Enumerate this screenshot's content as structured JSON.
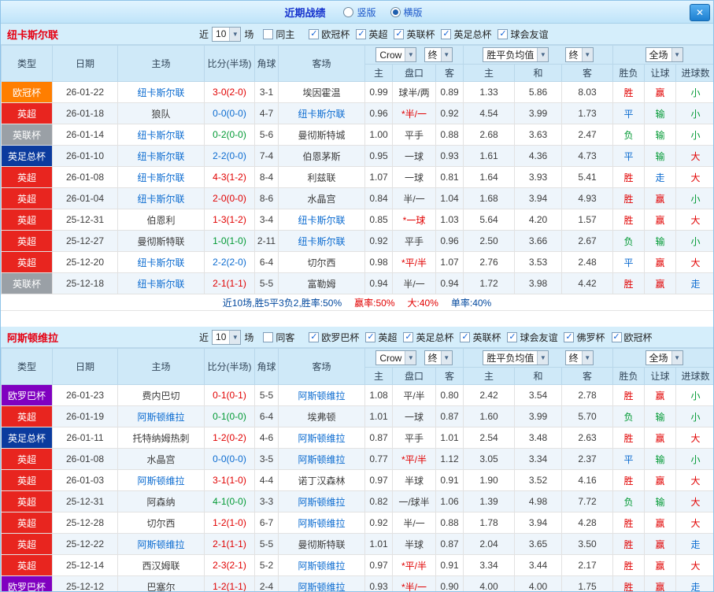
{
  "palette": {
    "red": "#e10000",
    "green": "#009933",
    "blue": "#0b6bd0",
    "dark": "#3c3c3c",
    "focal": "#0b6bd0",
    "navy_text": "#00479d",
    "league": {
      "欧冠杯": "#ff7e00",
      "英超": "#e8251f",
      "英联杯": "#9aa0a6",
      "英足总杯": "#0b3b9e",
      "欧罗巴杯": "#8000c0"
    }
  },
  "titlebar": {
    "title": "近期战绩",
    "vertical_label": "竖版",
    "horizontal_label": "横版",
    "close_glyph": "✕"
  },
  "controls": {
    "near_label": "近",
    "games_label": "场",
    "bookmaker": "Crow",
    "stage_final": "终",
    "avg_label": "胜平负均值",
    "scope": "全场",
    "check_glyph": "✓"
  },
  "table": {
    "cols": [
      "类型",
      "日期",
      "主场",
      "比分(半场)",
      "角球",
      "客场"
    ],
    "subcols": [
      "主",
      "盘口",
      "客",
      "主",
      "和",
      "客",
      "胜负",
      "让球",
      "进球数"
    ]
  },
  "sections": [
    {
      "team": "纽卡斯尔联",
      "count": "10",
      "same_label": "同主",
      "leagues": [
        "欧冠杯",
        "英超",
        "英联杯",
        "英足总杯",
        "球会友谊"
      ],
      "rows": [
        {
          "league": "欧冠杯",
          "date": "26-01-22",
          "home": "纽卡斯尔联",
          "home_c": "focal",
          "score": "3-0(2-0)",
          "score_c": "red",
          "corner": "3-1",
          "away": "埃因霍温",
          "away_c": "dark",
          "odds": [
            "0.99",
            "球半/两",
            "0.89"
          ],
          "pan_c": "dark",
          "avg": [
            "1.33",
            "5.86",
            "8.03"
          ],
          "res": [
            "胜",
            "red"
          ],
          "cover": [
            "赢",
            "red"
          ],
          "goals": [
            "小",
            "green"
          ]
        },
        {
          "league": "英超",
          "date": "26-01-18",
          "home": "狼队",
          "home_c": "dark",
          "score": "0-0(0-0)",
          "score_c": "blue",
          "corner": "4-7",
          "away": "纽卡斯尔联",
          "away_c": "focal",
          "odds": [
            "0.96",
            "*半/一",
            "0.92"
          ],
          "pan_c": "red",
          "avg": [
            "4.54",
            "3.99",
            "1.73"
          ],
          "res": [
            "平",
            "blue"
          ],
          "cover": [
            "输",
            "green"
          ],
          "goals": [
            "小",
            "green"
          ]
        },
        {
          "league": "英联杯",
          "date": "26-01-14",
          "home": "纽卡斯尔联",
          "home_c": "focal",
          "score": "0-2(0-0)",
          "score_c": "green",
          "corner": "5-6",
          "away": "曼彻斯特城",
          "away_c": "dark",
          "odds": [
            "1.00",
            "平手",
            "0.88"
          ],
          "pan_c": "dark",
          "avg": [
            "2.68",
            "3.63",
            "2.47"
          ],
          "res": [
            "负",
            "green"
          ],
          "cover": [
            "输",
            "green"
          ],
          "goals": [
            "小",
            "green"
          ]
        },
        {
          "league": "英足总杯",
          "date": "26-01-10",
          "home": "纽卡斯尔联",
          "home_c": "focal",
          "score": "2-2(0-0)",
          "score_c": "blue",
          "corner": "7-4",
          "away": "伯恩茅斯",
          "away_c": "dark",
          "odds": [
            "0.95",
            "一球",
            "0.93"
          ],
          "pan_c": "dark",
          "avg": [
            "1.61",
            "4.36",
            "4.73"
          ],
          "res": [
            "平",
            "blue"
          ],
          "cover": [
            "输",
            "green"
          ],
          "goals": [
            "大",
            "red"
          ]
        },
        {
          "league": "英超",
          "date": "26-01-08",
          "home": "纽卡斯尔联",
          "home_c": "focal",
          "score": "4-3(1-2)",
          "score_c": "red",
          "corner": "8-4",
          "away": "利兹联",
          "away_c": "dark",
          "odds": [
            "1.07",
            "一球",
            "0.81"
          ],
          "pan_c": "dark",
          "avg": [
            "1.64",
            "3.93",
            "5.41"
          ],
          "res": [
            "胜",
            "red"
          ],
          "cover": [
            "走",
            "blue"
          ],
          "goals": [
            "大",
            "red"
          ]
        },
        {
          "league": "英超",
          "date": "26-01-04",
          "home": "纽卡斯尔联",
          "home_c": "focal",
          "score": "2-0(0-0)",
          "score_c": "red",
          "corner": "8-6",
          "away": "水晶宫",
          "away_c": "dark",
          "odds": [
            "0.84",
            "半/一",
            "1.04"
          ],
          "pan_c": "dark",
          "avg": [
            "1.68",
            "3.94",
            "4.93"
          ],
          "res": [
            "胜",
            "red"
          ],
          "cover": [
            "赢",
            "red"
          ],
          "goals": [
            "小",
            "green"
          ]
        },
        {
          "league": "英超",
          "date": "25-12-31",
          "home": "伯恩利",
          "home_c": "dark",
          "score": "1-3(1-2)",
          "score_c": "red",
          "corner": "3-4",
          "away": "纽卡斯尔联",
          "away_c": "focal",
          "odds": [
            "0.85",
            "*一球",
            "1.03"
          ],
          "pan_c": "red",
          "avg": [
            "5.64",
            "4.20",
            "1.57"
          ],
          "res": [
            "胜",
            "red"
          ],
          "cover": [
            "赢",
            "red"
          ],
          "goals": [
            "大",
            "red"
          ]
        },
        {
          "league": "英超",
          "date": "25-12-27",
          "home": "曼彻斯特联",
          "home_c": "dark",
          "score": "1-0(1-0)",
          "score_c": "green",
          "corner": "2-11",
          "away": "纽卡斯尔联",
          "away_c": "focal",
          "odds": [
            "0.92",
            "平手",
            "0.96"
          ],
          "pan_c": "dark",
          "avg": [
            "2.50",
            "3.66",
            "2.67"
          ],
          "res": [
            "负",
            "green"
          ],
          "cover": [
            "输",
            "green"
          ],
          "goals": [
            "小",
            "green"
          ]
        },
        {
          "league": "英超",
          "date": "25-12-20",
          "home": "纽卡斯尔联",
          "home_c": "focal",
          "score": "2-2(2-0)",
          "score_c": "blue",
          "corner": "6-4",
          "away": "切尔西",
          "away_c": "dark",
          "odds": [
            "0.98",
            "*平/半",
            "1.07"
          ],
          "pan_c": "red",
          "avg": [
            "2.76",
            "3.53",
            "2.48"
          ],
          "res": [
            "平",
            "blue"
          ],
          "cover": [
            "赢",
            "red"
          ],
          "goals": [
            "大",
            "red"
          ]
        },
        {
          "league": "英联杯",
          "date": "25-12-18",
          "home": "纽卡斯尔联",
          "home_c": "focal",
          "score": "2-1(1-1)",
          "score_c": "red",
          "corner": "5-5",
          "away": "富勒姆",
          "away_c": "dark",
          "odds": [
            "0.94",
            "半/一",
            "0.94"
          ],
          "pan_c": "dark",
          "avg": [
            "1.72",
            "3.98",
            "4.42"
          ],
          "res": [
            "胜",
            "red"
          ],
          "cover": [
            "赢",
            "red"
          ],
          "goals": [
            "走",
            "blue"
          ]
        }
      ],
      "summary": [
        [
          "近10场,胜5平3负2,胜率:50%",
          "navy_text"
        ],
        [
          "赢率:50%",
          "red"
        ],
        [
          "大:40%",
          "red"
        ],
        [
          "单率:40%",
          "navy_text"
        ]
      ]
    },
    {
      "team": "阿斯顿维拉",
      "count": "10",
      "same_label": "同客",
      "leagues": [
        "欧罗巴杯",
        "英超",
        "英足总杯",
        "英联杯",
        "球会友谊",
        "佛罗杯",
        "欧冠杯"
      ],
      "rows": [
        {
          "league": "欧罗巴杯",
          "date": "26-01-23",
          "home": "费内巴切",
          "home_c": "dark",
          "score": "0-1(0-1)",
          "score_c": "red",
          "corner": "5-5",
          "away": "阿斯顿维拉",
          "away_c": "focal",
          "odds": [
            "1.08",
            "平/半",
            "0.80"
          ],
          "pan_c": "dark",
          "avg": [
            "2.42",
            "3.54",
            "2.78"
          ],
          "res": [
            "胜",
            "red"
          ],
          "cover": [
            "赢",
            "red"
          ],
          "goals": [
            "小",
            "green"
          ]
        },
        {
          "league": "英超",
          "date": "26-01-19",
          "home": "阿斯顿维拉",
          "home_c": "focal",
          "score": "0-1(0-0)",
          "score_c": "green",
          "corner": "6-4",
          "away": "埃弗顿",
          "away_c": "dark",
          "odds": [
            "1.01",
            "一球",
            "0.87"
          ],
          "pan_c": "dark",
          "avg": [
            "1.60",
            "3.99",
            "5.70"
          ],
          "res": [
            "负",
            "green"
          ],
          "cover": [
            "输",
            "green"
          ],
          "goals": [
            "小",
            "green"
          ]
        },
        {
          "league": "英足总杯",
          "date": "26-01-11",
          "home": "托特纳姆热刺",
          "home_c": "dark",
          "score": "1-2(0-2)",
          "score_c": "red",
          "corner": "4-6",
          "away": "阿斯顿维拉",
          "away_c": "focal",
          "odds": [
            "0.87",
            "平手",
            "1.01"
          ],
          "pan_c": "dark",
          "avg": [
            "2.54",
            "3.48",
            "2.63"
          ],
          "res": [
            "胜",
            "red"
          ],
          "cover": [
            "赢",
            "red"
          ],
          "goals": [
            "大",
            "red"
          ]
        },
        {
          "league": "英超",
          "date": "26-01-08",
          "home": "水晶宫",
          "home_c": "dark",
          "score": "0-0(0-0)",
          "score_c": "blue",
          "corner": "3-5",
          "away": "阿斯顿维拉",
          "away_c": "focal",
          "odds": [
            "0.77",
            "*平/半",
            "1.12"
          ],
          "pan_c": "red",
          "avg": [
            "3.05",
            "3.34",
            "2.37"
          ],
          "res": [
            "平",
            "blue"
          ],
          "cover": [
            "输",
            "green"
          ],
          "goals": [
            "小",
            "green"
          ]
        },
        {
          "league": "英超",
          "date": "26-01-03",
          "home": "阿斯顿维拉",
          "home_c": "focal",
          "score": "3-1(1-0)",
          "score_c": "red",
          "corner": "4-4",
          "away": "诺丁汉森林",
          "away_c": "dark",
          "odds": [
            "0.97",
            "半球",
            "0.91"
          ],
          "pan_c": "dark",
          "avg": [
            "1.90",
            "3.52",
            "4.16"
          ],
          "res": [
            "胜",
            "red"
          ],
          "cover": [
            "赢",
            "red"
          ],
          "goals": [
            "大",
            "red"
          ]
        },
        {
          "league": "英超",
          "date": "25-12-31",
          "home": "阿森纳",
          "home_c": "dark",
          "score": "4-1(0-0)",
          "score_c": "green",
          "corner": "3-3",
          "away": "阿斯顿维拉",
          "away_c": "focal",
          "odds": [
            "0.82",
            "一/球半",
            "1.06"
          ],
          "pan_c": "dark",
          "avg": [
            "1.39",
            "4.98",
            "7.72"
          ],
          "res": [
            "负",
            "green"
          ],
          "cover": [
            "输",
            "green"
          ],
          "goals": [
            "大",
            "red"
          ]
        },
        {
          "league": "英超",
          "date": "25-12-28",
          "home": "切尔西",
          "home_c": "dark",
          "score": "1-2(1-0)",
          "score_c": "red",
          "corner": "6-7",
          "away": "阿斯顿维拉",
          "away_c": "focal",
          "odds": [
            "0.92",
            "半/一",
            "0.88"
          ],
          "pan_c": "dark",
          "avg": [
            "1.78",
            "3.94",
            "4.28"
          ],
          "res": [
            "胜",
            "red"
          ],
          "cover": [
            "赢",
            "red"
          ],
          "goals": [
            "大",
            "red"
          ]
        },
        {
          "league": "英超",
          "date": "25-12-22",
          "home": "阿斯顿维拉",
          "home_c": "focal",
          "score": "2-1(1-1)",
          "score_c": "red",
          "corner": "5-5",
          "away": "曼彻斯特联",
          "away_c": "dark",
          "odds": [
            "1.01",
            "半球",
            "0.87"
          ],
          "pan_c": "dark",
          "avg": [
            "2.04",
            "3.65",
            "3.50"
          ],
          "res": [
            "胜",
            "red"
          ],
          "cover": [
            "赢",
            "red"
          ],
          "goals": [
            "走",
            "blue"
          ]
        },
        {
          "league": "英超",
          "date": "25-12-14",
          "home": "西汉姆联",
          "home_c": "dark",
          "score": "2-3(2-1)",
          "score_c": "red",
          "corner": "5-2",
          "away": "阿斯顿维拉",
          "away_c": "focal",
          "odds": [
            "0.97",
            "*平/半",
            "0.91"
          ],
          "pan_c": "red",
          "avg": [
            "3.34",
            "3.44",
            "2.17"
          ],
          "res": [
            "胜",
            "red"
          ],
          "cover": [
            "赢",
            "red"
          ],
          "goals": [
            "大",
            "red"
          ]
        },
        {
          "league": "欧罗巴杯",
          "date": "25-12-12",
          "home": "巴塞尔",
          "home_c": "dark",
          "score": "1-2(1-1)",
          "score_c": "red",
          "corner": "2-4",
          "away": "阿斯顿维拉",
          "away_c": "focal",
          "odds": [
            "0.93",
            "*半/一",
            "0.90"
          ],
          "pan_c": "red",
          "avg": [
            "4.00",
            "4.00",
            "1.75"
          ],
          "res": [
            "胜",
            "red"
          ],
          "cover": [
            "赢",
            "red"
          ],
          "goals": [
            "走",
            "blue"
          ]
        }
      ]
    }
  ]
}
